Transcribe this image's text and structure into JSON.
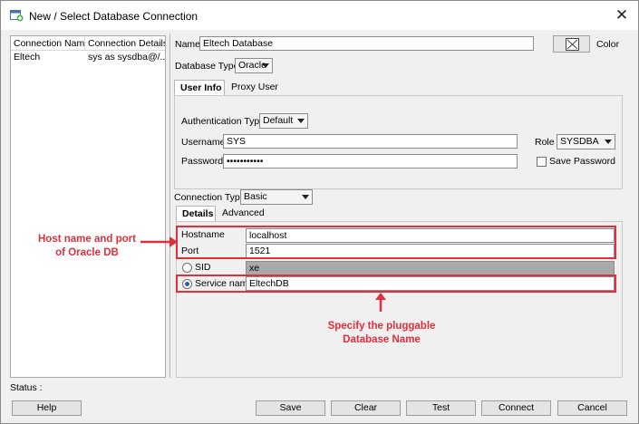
{
  "window": {
    "title": "New / Select Database Connection",
    "close_glyph": "✕"
  },
  "connections": {
    "columns": [
      "Connection Name",
      "Connection Details"
    ],
    "rows": [
      {
        "name": "Eltech",
        "details": "sys as sysdba@/..."
      }
    ]
  },
  "form": {
    "name_label": "Name",
    "name_value": "Eltech Database",
    "color_label": "Color",
    "db_type_label": "Database Type",
    "db_type_value": "Oracle",
    "tabs": [
      "User Info",
      "Proxy User"
    ],
    "auth_type_label": "Authentication Type",
    "auth_type_value": "Default",
    "username_label": "Username",
    "username_value": "SYS",
    "role_label": "Role",
    "role_value": "SYSDBA",
    "password_label": "Password",
    "password_value": "•••••••••••",
    "save_password_label": "Save Password",
    "conn_type_label": "Connection Type",
    "conn_type_value": "Basic",
    "detail_tabs": [
      "Details",
      "Advanced"
    ],
    "hostname_label": "Hostname",
    "hostname_value": "localhost",
    "port_label": "Port",
    "port_value": "1521",
    "sid_label": "SID",
    "sid_value": "xe",
    "service_name_label": "Service name",
    "service_name_value": "EltechDB"
  },
  "annotations": {
    "host_port": "Host name and port\nof Oracle DB",
    "service": "Specify the pluggable\nDatabase Name",
    "color": "#e0303b"
  },
  "status_label": "Status :",
  "buttons": {
    "help": "Help",
    "save": "Save",
    "clear": "Clear",
    "test": "Test",
    "connect": "Connect",
    "cancel": "Cancel"
  },
  "icons": [
    "database-connection-icon",
    "close-icon",
    "color-picker-icon",
    "dropdown-arrow-icon",
    "annotation-arrow-icon"
  ]
}
